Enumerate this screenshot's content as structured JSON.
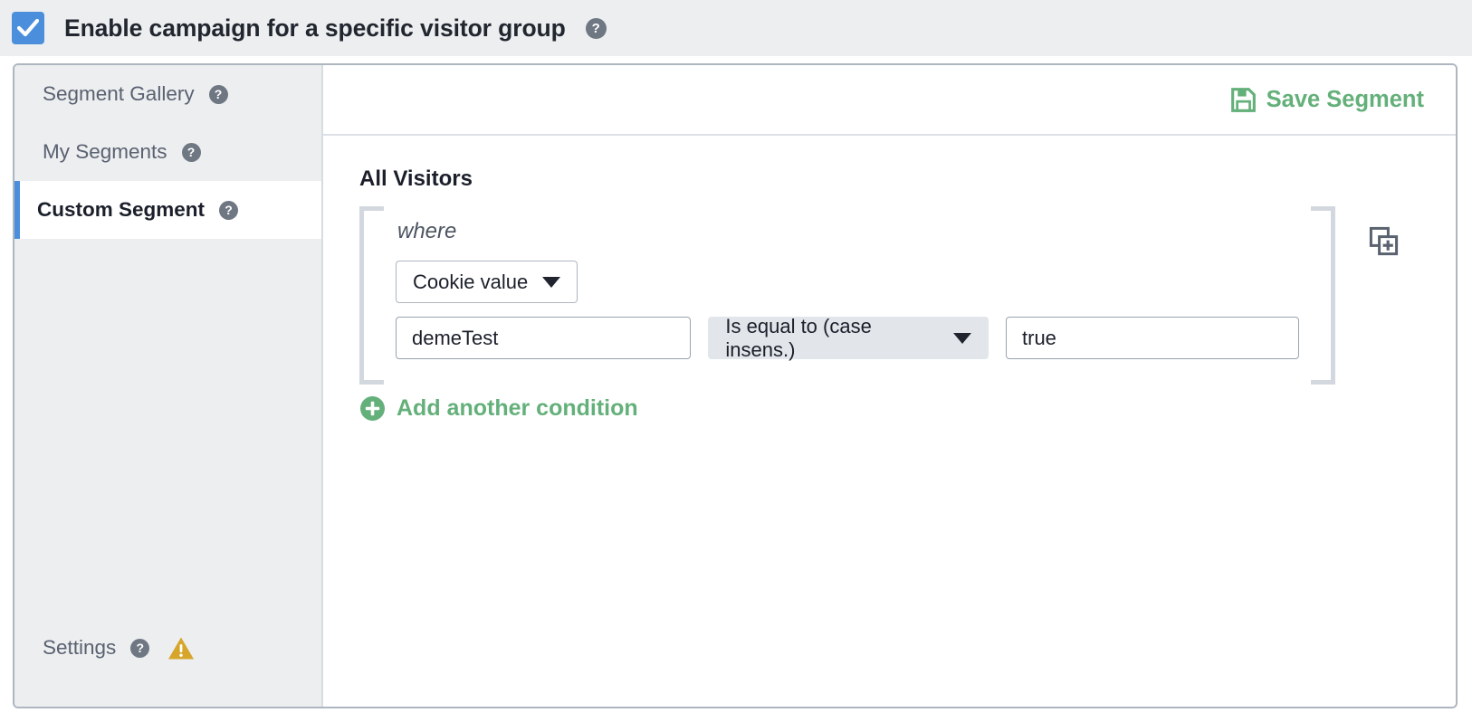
{
  "header": {
    "checkbox_checked": true,
    "title": "Enable campaign for a specific visitor group",
    "help_label": "?"
  },
  "sidebar": {
    "items": [
      {
        "label": "Segment Gallery",
        "active": false,
        "help_label": "?"
      },
      {
        "label": "My Segments",
        "active": false,
        "help_label": "?"
      },
      {
        "label": "Custom Segment",
        "active": true,
        "help_label": "?"
      }
    ],
    "settings": {
      "label": "Settings",
      "help_label": "?",
      "warning_icon": "warning-triangle-icon"
    }
  },
  "main": {
    "save_button": {
      "label": "Save Segment",
      "icon": "floppy-disk-save-icon"
    },
    "segment_title": "All Visitors",
    "condition_group": {
      "connector": "where",
      "attribute_select": "Cookie value",
      "name_value": "demeTest",
      "operator_select": "Is equal to (case insens.)",
      "match_value": "true",
      "duplicate_icon": "duplicate-group-icon"
    },
    "add_condition": {
      "label": "Add another condition",
      "icon": "plus-circle-icon"
    }
  },
  "colors": {
    "accent_blue": "#4b8fdc",
    "accent_green": "#64b07a",
    "warning_amber": "#d6a52a",
    "help_grey": "#6f7783",
    "panel_border": "#aeb6c0",
    "sidebar_bg": "#eceef0"
  }
}
